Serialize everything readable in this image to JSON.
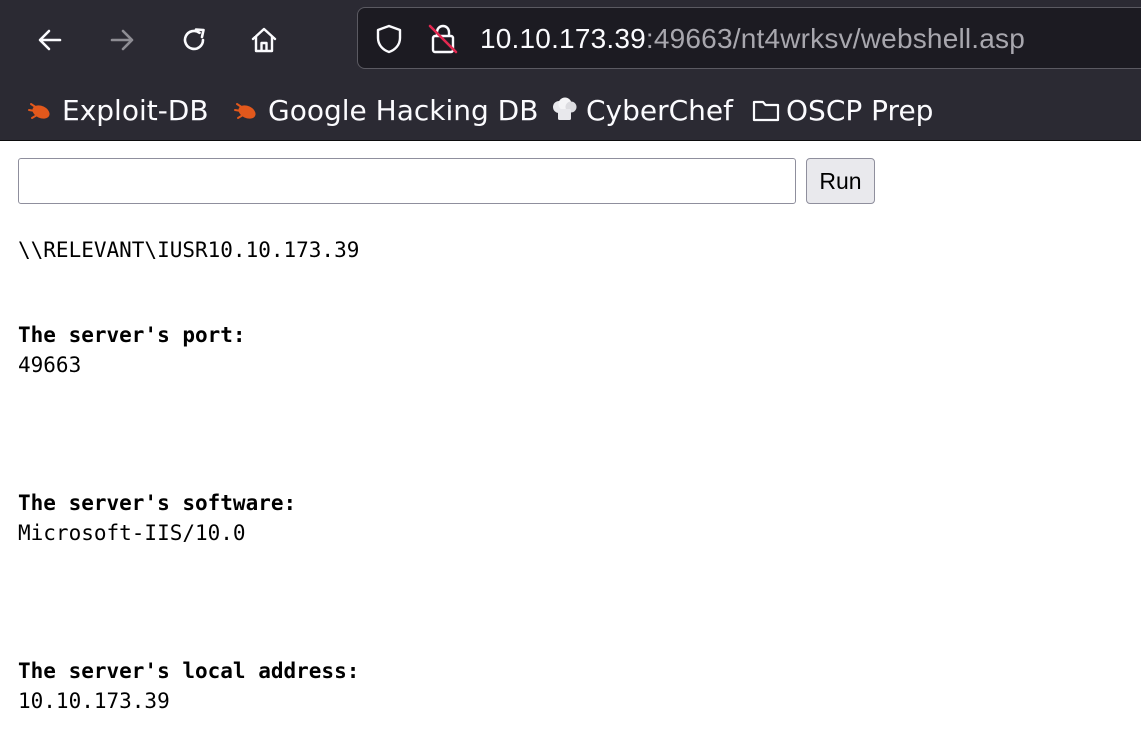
{
  "browser": {
    "url_host": "10.10.173.39",
    "url_rest": ":49663/nt4wrksv/webshell.asp",
    "nav_icons": [
      "back-arrow-icon",
      "forward-arrow-icon",
      "reload-icon",
      "home-icon"
    ],
    "url_icons": [
      "shield-icon",
      "insecure-lock-icon"
    ],
    "bookmarks": [
      {
        "label": "Exploit-DB",
        "icon": "exploit-db-bug-icon"
      },
      {
        "label": "Google Hacking DB",
        "icon": "ghdb-bug-icon"
      },
      {
        "label": "CyberChef",
        "icon": "chef-hat-icon"
      },
      {
        "label": "OSCP Prep",
        "icon": "folder-icon"
      }
    ],
    "colors": {
      "toolbar_bg": "#2b2a33",
      "urlbar_bg": "#1c1b22",
      "text": "#fbfbfe",
      "muted_text": "#a8a7ae",
      "insecure_red": "#e22850",
      "bug_orange": "#e2581c"
    }
  },
  "page": {
    "command_input": {
      "value": "",
      "placeholder": ""
    },
    "run_button_label": "Run",
    "user_line": "\\\\RELEVANT\\IUSR10.10.173.39",
    "port_label": "The server's port:",
    "port_value": "49663",
    "software_label": "The server's software:",
    "software_value": "Microsoft-IIS/10.0",
    "address_label": "The server's local address:",
    "address_value": "10.10.173.39"
  }
}
